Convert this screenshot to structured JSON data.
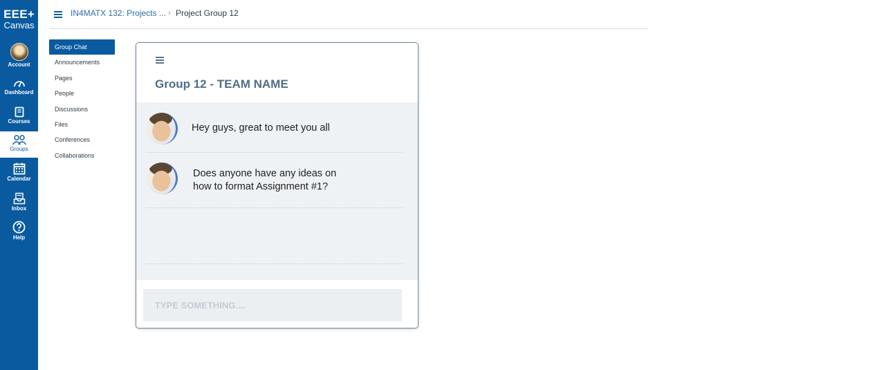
{
  "app": {
    "logo_line1": "EEE+",
    "logo_line2": "Canvas"
  },
  "global_nav": [
    {
      "label": "Account",
      "icon": "account-avatar-icon"
    },
    {
      "label": "Dashboard",
      "icon": "dashboard-icon"
    },
    {
      "label": "Courses",
      "icon": "courses-icon"
    },
    {
      "label": "Groups",
      "icon": "groups-icon",
      "active": true
    },
    {
      "label": "Calendar",
      "icon": "calendar-icon"
    },
    {
      "label": "Inbox",
      "icon": "inbox-icon"
    },
    {
      "label": "Help",
      "icon": "help-icon"
    }
  ],
  "header": {
    "breadcrumb_course": "IN4MATX 132: Projects ...",
    "breadcrumb_separator": "›",
    "breadcrumb_current": "Project Group 12"
  },
  "course_nav": [
    {
      "label": "Group Chat",
      "active": true
    },
    {
      "label": "Announcements"
    },
    {
      "label": "Pages"
    },
    {
      "label": "People"
    },
    {
      "label": "Discussions"
    },
    {
      "label": "Files"
    },
    {
      "label": "Conferences"
    },
    {
      "label": "Collaborations"
    }
  ],
  "chat": {
    "title": "Group 12 - TEAM NAME",
    "messages": [
      {
        "line1": "Hey guys, great to meet you all",
        "line2": ""
      },
      {
        "line1": "Does anyone have any ideas on",
        "line2": "how to format Assignment #1?"
      }
    ],
    "input_placeholder": "TYPE SOMETHING...."
  },
  "colors": {
    "brand": "#0a5aa0",
    "chat_bg": "#eff2f5",
    "title": "#4f6d86"
  }
}
